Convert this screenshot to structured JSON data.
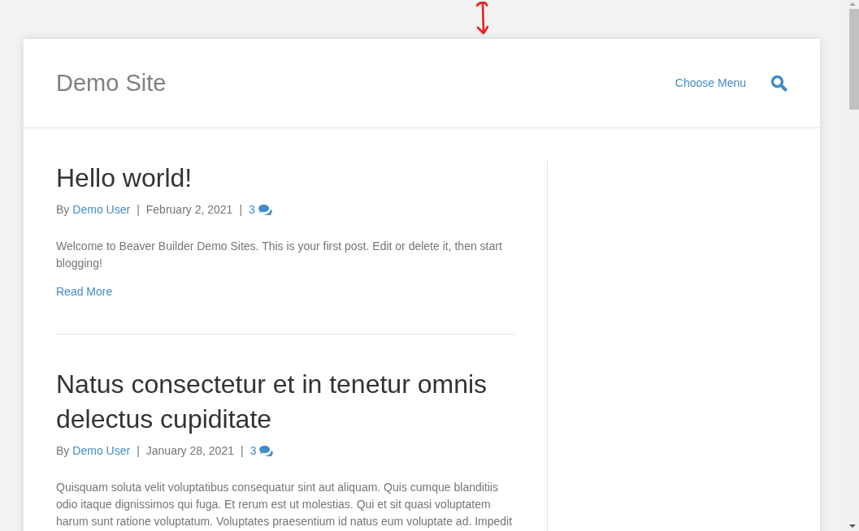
{
  "site_title": "Demo Site",
  "nav": {
    "menu_label": "Choose Menu"
  },
  "posts": [
    {
      "title": "Hello world!",
      "meta": {
        "by": "By",
        "author": "Demo User",
        "separator_1": "|",
        "date": "February 2, 2021",
        "separator_2": "|",
        "comments": "3"
      },
      "excerpt": "Welcome to Beaver Builder Demo Sites. This is your first post. Edit or delete it, then start blogging!",
      "read_more": "Read More"
    },
    {
      "title": "Natus consectetur et in tenetur omnis delectus cupiditate",
      "meta": {
        "by": "By",
        "author": "Demo User",
        "separator_1": "|",
        "date": "January 28, 2021",
        "separator_2": "|",
        "comments": "3"
      },
      "excerpt": "Quisquam soluta velit voluptatibus consequatur sint aut aliquam. Quis cumque blanditiis odio itaque dignissimos qui fuga. Et rerum est ut molestias. Qui et sit quasi voluptatem harum sunt ratione voluptatum. Voluptates praesentium id natus eum voluptate ad. Impedit"
    }
  ]
}
